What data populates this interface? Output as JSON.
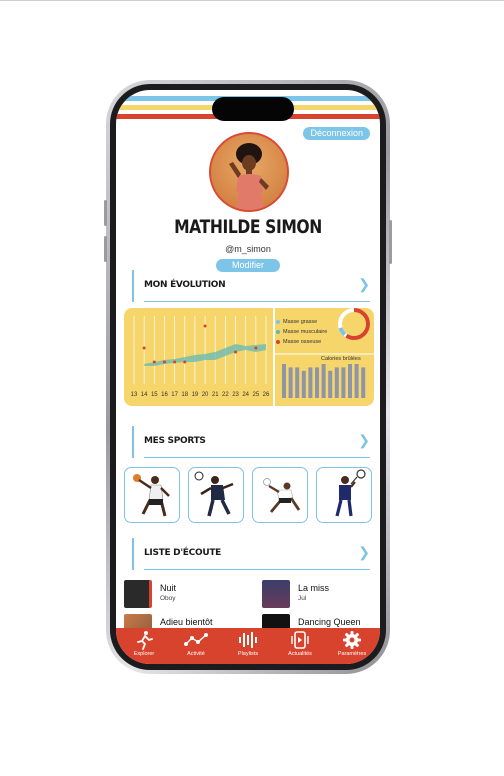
{
  "profile": {
    "logout_label": "Déconnexion",
    "name": "MATHILDE SIMON",
    "handle": "@m_simon",
    "edit_label": "Modifier"
  },
  "sections": {
    "evolution": "MON ÉVOLUTION",
    "sports": "MES SPORTS",
    "playlist": "LISTE D'ÉCOUTE"
  },
  "chart_data": {
    "type": "area",
    "x_ticks": [
      "13",
      "14",
      "15",
      "16",
      "17",
      "18",
      "19",
      "20",
      "21",
      "22",
      "23",
      "24",
      "25",
      "26"
    ],
    "legend": [
      "Masse grasse",
      "Masse musculaire",
      "Masse osseuse"
    ],
    "legend_colors": [
      "#7cc5e8",
      "#5fb8a8",
      "#d8432e"
    ],
    "calories_title": "Calories brûlées",
    "calories_values": [
      10,
      9,
      9,
      8,
      9,
      9,
      10,
      8,
      9,
      9,
      10,
      10,
      9
    ],
    "grid": true
  },
  "sports": [
    {
      "icon": "basketball-player-icon"
    },
    {
      "icon": "football-player-icon"
    },
    {
      "icon": "volleyball-player-icon"
    },
    {
      "icon": "tennis-player-icon"
    }
  ],
  "tracks": [
    {
      "title": "Nuit",
      "artist": "Oboy"
    },
    {
      "title": "La miss",
      "artist": "Jul"
    },
    {
      "title": "Adieu bientôt",
      "artist": ""
    },
    {
      "title": "Dancing Queen",
      "artist": ""
    }
  ],
  "tabs": [
    {
      "label": "Explorer",
      "icon": "run-icon"
    },
    {
      "label": "Activité",
      "icon": "activity-icon"
    },
    {
      "label": "Playlists",
      "icon": "waveform-icon"
    },
    {
      "label": "Actualités",
      "icon": "news-icon"
    },
    {
      "label": "Paramètres",
      "icon": "gear-icon"
    }
  ],
  "colors": {
    "accent_blue": "#7cc5e8",
    "accent_red": "#d8432e",
    "accent_yellow": "#f6d56a"
  }
}
